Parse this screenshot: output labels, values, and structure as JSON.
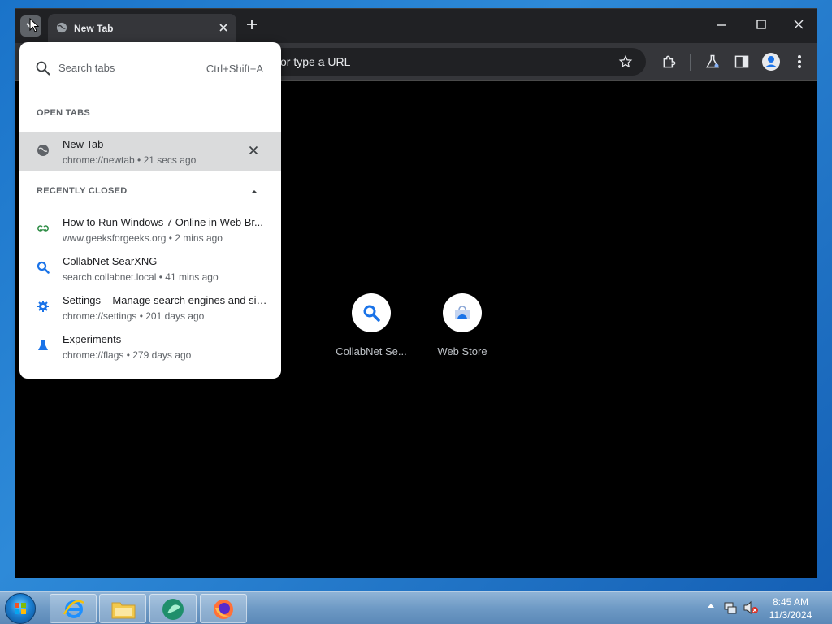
{
  "browser": {
    "tab_title": "New Tab",
    "omnibox_placeholder": "or type a URL"
  },
  "shortcuts": [
    {
      "label": "CollabNet Se...",
      "icon": "magnifier-icon"
    },
    {
      "label": "Web Store",
      "icon": "web-store-icon"
    }
  ],
  "tab_search": {
    "placeholder": "Search tabs",
    "shortcut": "Ctrl+Shift+A",
    "open_tabs_label": "OPEN TABS",
    "open_tabs": [
      {
        "title": "New Tab",
        "subtitle": "chrome://newtab • 21 secs ago",
        "icon": "globe-icon"
      }
    ],
    "recently_closed_label": "RECENTLY CLOSED",
    "recently_closed": [
      {
        "title": "How to Run Windows 7 Online in Web Br...",
        "subtitle": "www.geeksforgeeks.org • 2 mins ago",
        "icon": "geeksforgeeks-icon"
      },
      {
        "title": "CollabNet SearXNG",
        "subtitle": "search.collabnet.local • 41 mins ago",
        "icon": "magnifier-icon"
      },
      {
        "title": "Settings – Manage search engines and sit...",
        "subtitle": "chrome://settings • 201 days ago",
        "icon": "gear-icon"
      },
      {
        "title": "Experiments",
        "subtitle": "chrome://flags • 279 days ago",
        "icon": "flask-icon"
      }
    ]
  },
  "taskbar": {
    "time": "8:45 AM",
    "date": "11/3/2024"
  },
  "colors": {
    "accent_blue": "#1a73e8",
    "gfg_green": "#2f8d46",
    "window_bg": "#000000",
    "titlebar": "#202124",
    "toolbar": "#35363a"
  }
}
